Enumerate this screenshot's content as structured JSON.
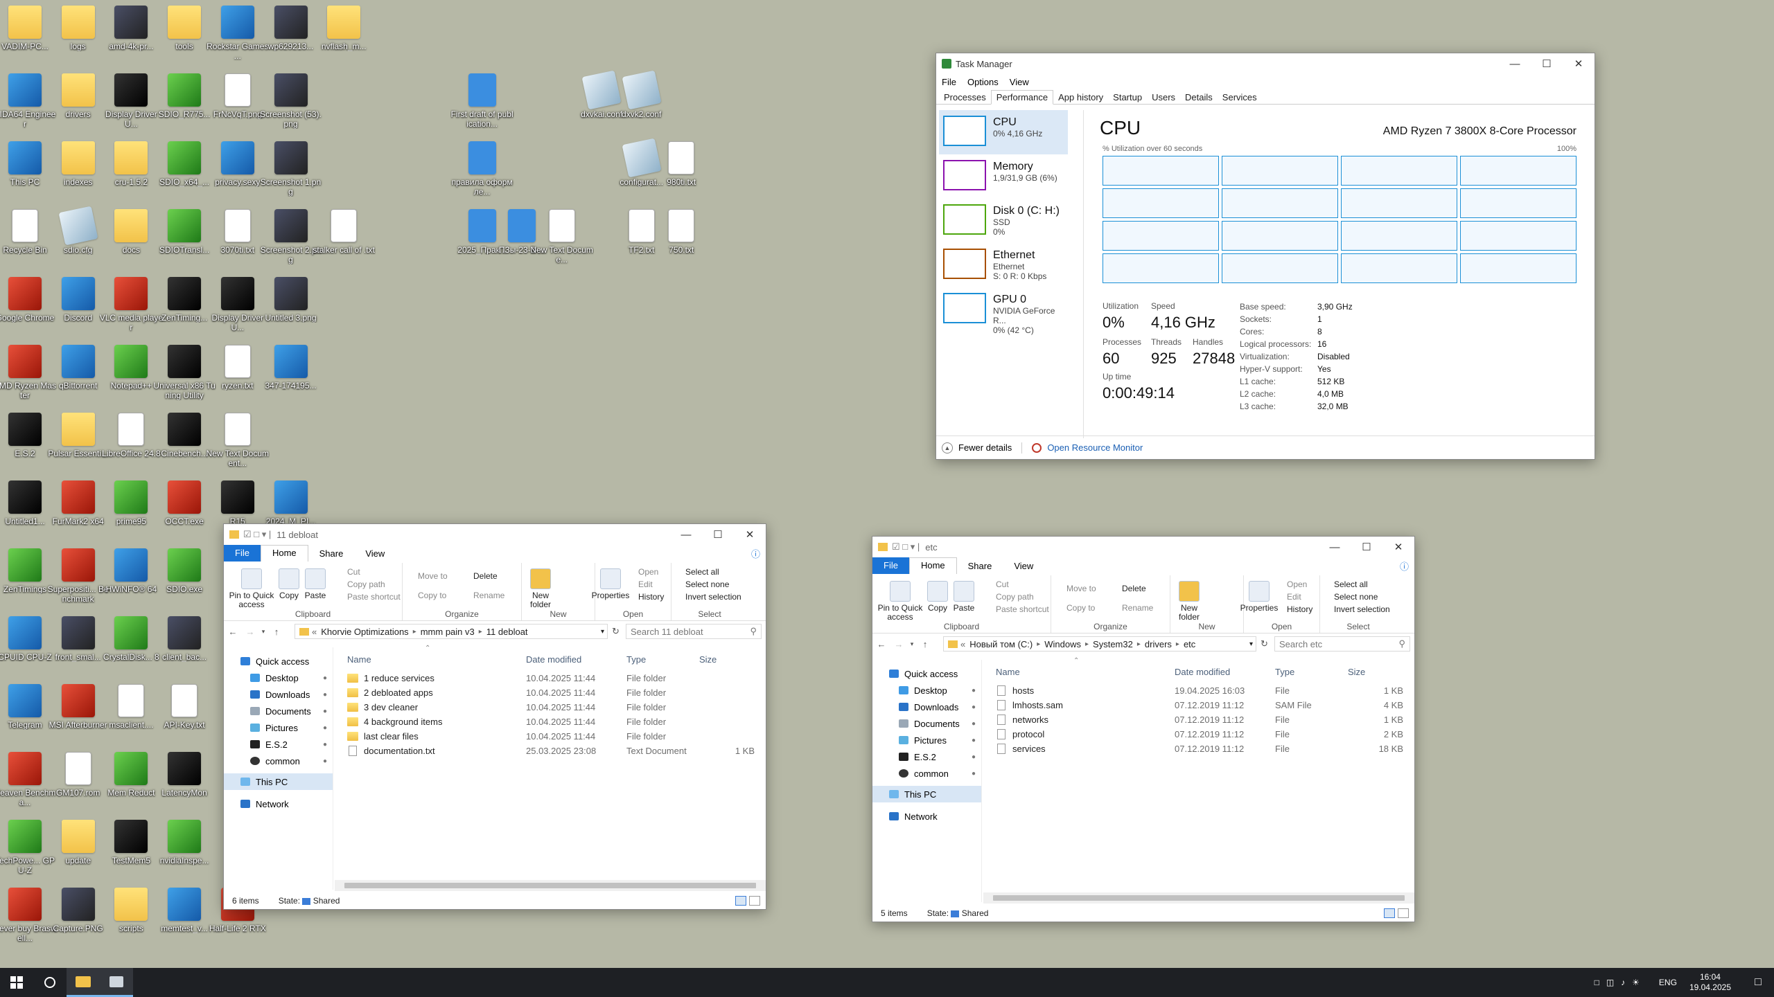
{
  "desktop": [
    {
      "label": "VADIM-PC...",
      "kind": "folder",
      "col": 0,
      "row": 0
    },
    {
      "label": "logs",
      "kind": "folder",
      "col": 1,
      "row": 0
    },
    {
      "label": "amd-4k-pr...",
      "kind": "img",
      "col": 2,
      "row": 0
    },
    {
      "label": "tools",
      "kind": "folder",
      "col": 3,
      "row": 0
    },
    {
      "label": "Rockstar Games ...",
      "kind": "app",
      "col": 4,
      "row": 0
    },
    {
      "label": "wp629213...",
      "kind": "img",
      "col": 5,
      "row": 0
    },
    {
      "label": "nvflash_m...",
      "kind": "folder",
      "col": 6,
      "row": 0
    },
    {
      "label": "AIDA64 Engineer",
      "kind": "app",
      "col": 0,
      "row": 1
    },
    {
      "label": "drivers",
      "kind": "folder",
      "col": 1,
      "row": 1
    },
    {
      "label": "Display Driver U...",
      "kind": "dark",
      "col": 2,
      "row": 1
    },
    {
      "label": "SDIO_R775...",
      "kind": "grn",
      "col": 3,
      "row": 1
    },
    {
      "label": "FrNcVqT.png",
      "kind": "file",
      "col": 4,
      "row": 1
    },
    {
      "label": "Screenshot (53).png",
      "kind": "img",
      "col": 5,
      "row": 1
    },
    {
      "label": "This PC",
      "kind": "app",
      "col": 0,
      "row": 2
    },
    {
      "label": "indexes",
      "kind": "folder",
      "col": 1,
      "row": 2
    },
    {
      "label": "cru-1.5.2",
      "kind": "folder",
      "col": 2,
      "row": 2
    },
    {
      "label": "SDIO_x64_...",
      "kind": "grn",
      "col": 3,
      "row": 2
    },
    {
      "label": "privacy.sexy",
      "kind": "app",
      "col": 4,
      "row": 2
    },
    {
      "label": "Screenshot 1.png",
      "kind": "img",
      "col": 5,
      "row": 2
    },
    {
      "label": "Recycle Bin",
      "kind": "file",
      "col": 0,
      "row": 3
    },
    {
      "label": "sdio.cfg",
      "kind": "cfg",
      "col": 1,
      "row": 3
    },
    {
      "label": "docs",
      "kind": "folder",
      "col": 2,
      "row": 3
    },
    {
      "label": "SDIOTransl...",
      "kind": "grn",
      "col": 3,
      "row": 3
    },
    {
      "label": "3070ti.txt",
      "kind": "file",
      "col": 4,
      "row": 3
    },
    {
      "label": "Screenshot 2.png",
      "kind": "img",
      "col": 5,
      "row": 3
    },
    {
      "label": "stalker call of .txt",
      "kind": "file",
      "col": 6,
      "row": 3
    },
    {
      "label": "Google Chrome",
      "kind": "red",
      "col": 0,
      "row": 4
    },
    {
      "label": "Discord",
      "kind": "app",
      "col": 1,
      "row": 4
    },
    {
      "label": "VLC media player",
      "kind": "red",
      "col": 2,
      "row": 4
    },
    {
      "label": "ZenTiming...",
      "kind": "dark",
      "col": 3,
      "row": 4
    },
    {
      "label": "Display Driver U...",
      "kind": "dark",
      "col": 4,
      "row": 4
    },
    {
      "label": "Untitled 3.png",
      "kind": "img",
      "col": 5,
      "row": 4
    },
    {
      "label": "AMD Ryzen Master",
      "kind": "red",
      "col": 0,
      "row": 5
    },
    {
      "label": "qBittorrent",
      "kind": "app",
      "col": 1,
      "row": 5
    },
    {
      "label": "Notepad++",
      "kind": "grn",
      "col": 2,
      "row": 5
    },
    {
      "label": "Universal x86 Tuning Utility",
      "kind": "dark",
      "col": 3,
      "row": 5
    },
    {
      "label": "ryzen.txt",
      "kind": "file",
      "col": 4,
      "row": 5
    },
    {
      "label": "347-174195...",
      "kind": "app",
      "col": 5,
      "row": 5
    },
    {
      "label": "E.S.2",
      "kind": "dark",
      "col": 0,
      "row": 6
    },
    {
      "label": "Pulsar Essenti...",
      "kind": "folder",
      "col": 1,
      "row": 6
    },
    {
      "label": "LibreOffice 24.8",
      "kind": "file",
      "col": 2,
      "row": 6
    },
    {
      "label": "Cinebench...",
      "kind": "dark",
      "col": 3,
      "row": 6
    },
    {
      "label": "New Text Document...",
      "kind": "file",
      "col": 4,
      "row": 6
    },
    {
      "label": "Untitled1...",
      "kind": "dark",
      "col": 0,
      "row": 7
    },
    {
      "label": "FurMark2 x64",
      "kind": "red",
      "col": 1,
      "row": 7
    },
    {
      "label": "prime95",
      "kind": "grn",
      "col": 2,
      "row": 7
    },
    {
      "label": "OCCT.exe",
      "kind": "red",
      "col": 3,
      "row": 7
    },
    {
      "label": "R15",
      "kind": "dark",
      "col": 4,
      "row": 7
    },
    {
      "label": "2024_M_PI...",
      "kind": "app",
      "col": 5,
      "row": 7
    },
    {
      "label": "ZenTimings",
      "kind": "grn",
      "col": 0,
      "row": 8
    },
    {
      "label": "Superpositi... Benchmark",
      "kind": "red",
      "col": 1,
      "row": 8
    },
    {
      "label": "HWiNFO® 64",
      "kind": "app",
      "col": 2,
      "row": 8
    },
    {
      "label": "SDIO.exe",
      "kind": "grn",
      "col": 3,
      "row": 8
    },
    {
      "label": "CPUID CPU-Z",
      "kind": "app",
      "col": 0,
      "row": 9
    },
    {
      "label": "front_smal...",
      "kind": "img",
      "col": 1,
      "row": 9
    },
    {
      "label": "CrystalDisk... 8",
      "kind": "grn",
      "col": 2,
      "row": 9
    },
    {
      "label": "client_bac...",
      "kind": "img",
      "col": 3,
      "row": 9
    },
    {
      "label": "Telegram",
      "kind": "app",
      "col": 0,
      "row": 10
    },
    {
      "label": "MSI Afterburner",
      "kind": "red",
      "col": 1,
      "row": 10
    },
    {
      "label": "msaclient....",
      "kind": "file",
      "col": 2,
      "row": 10
    },
    {
      "label": "API-Key.txt",
      "kind": "file",
      "col": 3,
      "row": 10
    },
    {
      "label": "Heaven Benchma...",
      "kind": "red",
      "col": 0,
      "row": 11
    },
    {
      "label": "GM107.rom",
      "kind": "file",
      "col": 1,
      "row": 11
    },
    {
      "label": "Mem Reduct",
      "kind": "grn",
      "col": 2,
      "row": 11
    },
    {
      "label": "LatencyMon",
      "kind": "dark",
      "col": 3,
      "row": 11
    },
    {
      "label": "TechPowe... GPU-Z",
      "kind": "grn",
      "col": 0,
      "row": 12
    },
    {
      "label": "update",
      "kind": "folder",
      "col": 1,
      "row": 12
    },
    {
      "label": "TestMem5",
      "kind": "dark",
      "col": 2,
      "row": 12
    },
    {
      "label": "nvidiaInspe...",
      "kind": "grn",
      "col": 3,
      "row": 12
    },
    {
      "label": "Never buy Braswell...",
      "kind": "red",
      "col": 0,
      "row": 13
    },
    {
      "label": "Capture.PNG",
      "kind": "img",
      "col": 1,
      "row": 13
    },
    {
      "label": "scripts",
      "kind": "folder",
      "col": 2,
      "row": 13
    },
    {
      "label": "memtest_v...",
      "kind": "app",
      "col": 3,
      "row": 13
    },
    {
      "label": "Half-Life 2 RTX",
      "kind": "red",
      "col": 4,
      "row": 13
    },
    {
      "label": "First draft of publication...",
      "kind": "doc",
      "col": 8.6,
      "row": 1
    },
    {
      "label": "правила оформле...",
      "kind": "doc",
      "col": 8.6,
      "row": 2
    },
    {
      "label": "2025_Прак...",
      "kind": "doc",
      "col": 8.6,
      "row": 3
    },
    {
      "label": "ПЗы-23-3-...",
      "kind": "doc",
      "col": 9.35,
      "row": 3
    },
    {
      "label": "New Text Docume...",
      "kind": "file",
      "col": 10.1,
      "row": 3
    },
    {
      "label": "dxvkai.conf",
      "kind": "cfg",
      "col": 10.85,
      "row": 1
    },
    {
      "label": "dxvk2.conf",
      "kind": "cfg",
      "col": 11.6,
      "row": 1
    },
    {
      "label": "configurat...",
      "kind": "cfg",
      "col": 11.6,
      "row": 2
    },
    {
      "label": "980ti.txt",
      "kind": "file",
      "col": 12.35,
      "row": 2
    },
    {
      "label": "TF2.txt",
      "kind": "file",
      "col": 11.6,
      "row": 3
    },
    {
      "label": "750.txt",
      "kind": "file",
      "col": 12.35,
      "row": 3
    }
  ],
  "taskmgr": {
    "title": "Task Manager",
    "menu": [
      "File",
      "Options",
      "View"
    ],
    "tabs": [
      "Processes",
      "Performance",
      "App history",
      "Startup",
      "Users",
      "Details",
      "Services"
    ],
    "left": [
      {
        "name": "CPU",
        "l1": "0% 4,16 GHz",
        "l2": "",
        "l3": ""
      },
      {
        "name": "Memory",
        "l1": "1,9/31,9 GB (6%)",
        "l2": "",
        "l3": ""
      },
      {
        "name": "Disk 0 (C: H:)",
        "l1": "SSD",
        "l2": "0%",
        "l3": ""
      },
      {
        "name": "Ethernet",
        "l1": "Ethernet",
        "l2": "S: 0 R: 0 Kbps",
        "l3": ""
      },
      {
        "name": "GPU 0",
        "l1": "NVIDIA GeForce R...",
        "l2": "0% (42 °C)",
        "l3": ""
      }
    ],
    "heading": "CPU",
    "processor": "AMD Ryzen 7 3800X 8-Core Processor",
    "util_caption": "% Utilization over 60 seconds",
    "util_max": "100%",
    "stats": {
      "utilization_label": "Utilization",
      "utilization": "0%",
      "speed_label": "Speed",
      "speed": "4,16 GHz",
      "processes_label": "Processes",
      "processes": "60",
      "threads_label": "Threads",
      "threads": "925",
      "handles_label": "Handles",
      "handles": "27848",
      "uptime_label": "Up time",
      "uptime": "0:00:49:14"
    },
    "specs": [
      [
        "Base speed:",
        "3,90 GHz"
      ],
      [
        "Sockets:",
        "1"
      ],
      [
        "Cores:",
        "8"
      ],
      [
        "Logical processors:",
        "16"
      ],
      [
        "Virtualization:",
        "Disabled"
      ],
      [
        "Hyper-V support:",
        "Yes"
      ],
      [
        "L1 cache:",
        "512 KB"
      ],
      [
        "L2 cache:",
        "4,0 MB"
      ],
      [
        "L3 cache:",
        "32,0 MB"
      ]
    ],
    "fewer": "Fewer details",
    "resmon": "Open Resource Monitor"
  },
  "explorer1": {
    "title": "11 debloat",
    "ribbon_tabs": [
      "File",
      "Home",
      "Share",
      "View"
    ],
    "path": [
      "Khorvie Optimizations",
      "mmm pain v3",
      "11 debloat"
    ],
    "search_placeholder": "Search 11 debloat",
    "columns": [
      "Name",
      "Date modified",
      "Type",
      "Size"
    ],
    "rows": [
      {
        "name": "1 reduce services",
        "date": "10.04.2025 11:44",
        "type": "File folder",
        "size": "",
        "kind": "fold"
      },
      {
        "name": "2 debloated apps",
        "date": "10.04.2025 11:44",
        "type": "File folder",
        "size": "",
        "kind": "fold"
      },
      {
        "name": "3 dev cleaner",
        "date": "10.04.2025 11:44",
        "type": "File folder",
        "size": "",
        "kind": "fold"
      },
      {
        "name": "4 background items",
        "date": "10.04.2025 11:44",
        "type": "File folder",
        "size": "",
        "kind": "fold"
      },
      {
        "name": "last clear files",
        "date": "10.04.2025 11:44",
        "type": "File folder",
        "size": "",
        "kind": "fold"
      },
      {
        "name": "documentation.txt",
        "date": "25.03.2025 23:08",
        "type": "Text Document",
        "size": "1 KB",
        "kind": "txt"
      }
    ],
    "status_items": "6 items",
    "status_state": "State:",
    "status_shared": "Shared"
  },
  "explorer2": {
    "title": "etc",
    "ribbon_tabs": [
      "File",
      "Home",
      "Share",
      "View"
    ],
    "path": [
      "Новый том (C:)",
      "Windows",
      "System32",
      "drivers",
      "etc"
    ],
    "search_placeholder": "Search etc",
    "columns": [
      "Name",
      "Date modified",
      "Type",
      "Size"
    ],
    "rows": [
      {
        "name": "hosts",
        "date": "19.04.2025 16:03",
        "type": "File",
        "size": "1 KB",
        "kind": "txt"
      },
      {
        "name": "lmhosts.sam",
        "date": "07.12.2019 11:12",
        "type": "SAM File",
        "size": "4 KB",
        "kind": "txt"
      },
      {
        "name": "networks",
        "date": "07.12.2019 11:12",
        "type": "File",
        "size": "1 KB",
        "kind": "txt"
      },
      {
        "name": "protocol",
        "date": "07.12.2019 11:12",
        "type": "File",
        "size": "2 KB",
        "kind": "txt"
      },
      {
        "name": "services",
        "date": "07.12.2019 11:12",
        "type": "File",
        "size": "18 KB",
        "kind": "txt"
      }
    ],
    "status_items": "5 items",
    "status_state": "State:",
    "status_shared": "Shared"
  },
  "ribbon": {
    "pin": "Pin to Quick access",
    "copy": "Copy",
    "paste": "Paste",
    "cut": "Cut",
    "copy_path": "Copy path",
    "paste_shortcut": "Paste shortcut",
    "clipboard": "Clipboard",
    "move_to": "Move to",
    "copy_to": "Copy to",
    "delete": "Delete",
    "rename": "Rename",
    "organize": "Organize",
    "new_folder": "New folder",
    "new": "New",
    "properties": "Properties",
    "open": "Open",
    "edit": "Edit",
    "history": "History",
    "open_group": "Open",
    "select_all": "Select all",
    "select_none": "Select none",
    "invert": "Invert selection",
    "select": "Select"
  },
  "nav": {
    "quick": "Quick access",
    "desktop": "Desktop",
    "downloads": "Downloads",
    "documents": "Documents",
    "pictures": "Pictures",
    "es2": "E.S.2",
    "common": "common",
    "thispc": "This PC",
    "network": "Network"
  },
  "taskbar": {
    "lang": "ENG",
    "time": "16:04",
    "date": "19.04.2025"
  }
}
